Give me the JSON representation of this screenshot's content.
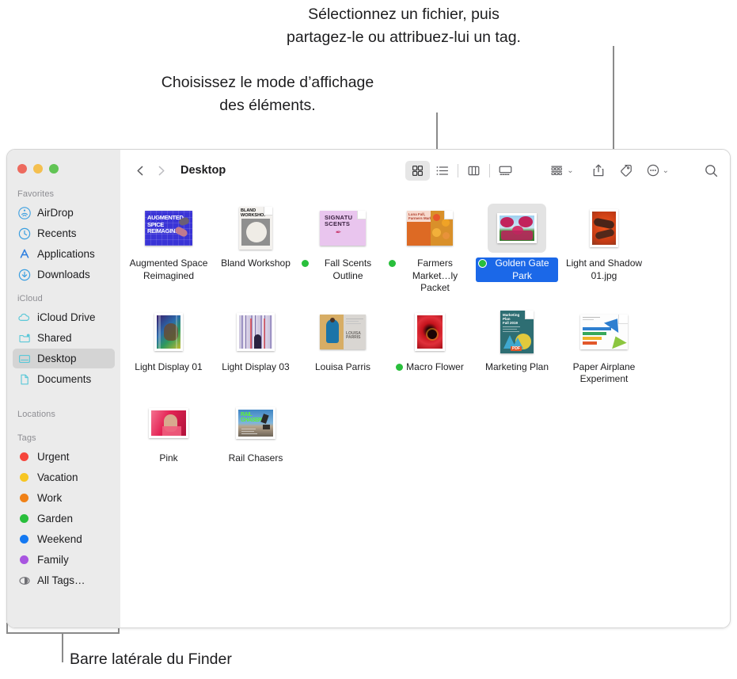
{
  "annotations": {
    "top": "Sélectionnez un fichier, puis\npartagez-le ou attribuez-lui un tag.",
    "left": "Choisissez le mode d’affichage\ndes éléments.",
    "bottom": "Barre latérale du Finder"
  },
  "window": {
    "traffic_lights": [
      "close",
      "minimize",
      "zoom"
    ],
    "colors": {
      "close": "#ed6a5e",
      "minimize": "#f4bf4f",
      "zoom": "#61c454"
    }
  },
  "toolbar": {
    "back_label": "Back",
    "forward_label": "Forward",
    "path_title": "Desktop",
    "views": [
      {
        "name": "icon-view",
        "label": "Icon View",
        "active": true
      },
      {
        "name": "list-view",
        "label": "List View",
        "active": false
      },
      {
        "name": "column-view",
        "label": "Column View",
        "active": false
      },
      {
        "name": "gallery-view",
        "label": "Gallery View",
        "active": false
      }
    ],
    "group_label": "Group",
    "share_label": "Share",
    "tag_label": "Tag",
    "more_label": "More",
    "search_label": "Search"
  },
  "sidebar": {
    "sections": [
      {
        "title": "Favorites",
        "items": [
          {
            "label": "AirDrop",
            "icon": "airdrop-icon",
            "selected": false
          },
          {
            "label": "Recents",
            "icon": "clock-icon",
            "selected": false
          },
          {
            "label": "Applications",
            "icon": "applications-icon",
            "selected": false
          },
          {
            "label": "Downloads",
            "icon": "downloads-icon",
            "selected": false
          }
        ]
      },
      {
        "title": "iCloud",
        "items": [
          {
            "label": "iCloud Drive",
            "icon": "cloud-icon",
            "selected": false
          },
          {
            "label": "Shared",
            "icon": "shared-folder-icon",
            "selected": false
          },
          {
            "label": "Desktop",
            "icon": "desktop-icon",
            "selected": true
          },
          {
            "label": "Documents",
            "icon": "document-icon",
            "selected": false
          }
        ]
      },
      {
        "title": "Locations",
        "items": []
      },
      {
        "title": "Tags",
        "items": [
          {
            "label": "Urgent",
            "icon": "tag-dot",
            "color": "#f6453c",
            "selected": false
          },
          {
            "label": "Vacation",
            "icon": "tag-dot",
            "color": "#f7c623",
            "selected": false
          },
          {
            "label": "Work",
            "icon": "tag-dot",
            "color": "#f08117",
            "selected": false
          },
          {
            "label": "Garden",
            "icon": "tag-dot",
            "color": "#29bf3c",
            "selected": false
          },
          {
            "label": "Weekend",
            "icon": "tag-dot",
            "color": "#1479f2",
            "selected": false
          },
          {
            "label": "Family",
            "icon": "tag-dot",
            "color": "#a855e0",
            "selected": false
          },
          {
            "label": "All Tags…",
            "icon": "all-tags-icon",
            "color": "",
            "selected": false
          }
        ]
      }
    ]
  },
  "files": [
    {
      "name": "Augmented\nSpace Reimagined",
      "kind": "poster",
      "tag": "",
      "selected": false
    },
    {
      "name": "Bland Workshop",
      "kind": "doc",
      "tag": "",
      "selected": false
    },
    {
      "name": "Fall Scents\nOutline",
      "kind": "doc",
      "tag": "#29bf3c",
      "selected": false
    },
    {
      "name": "Farmers\nMarket…ly Packet",
      "kind": "doc",
      "tag": "#29bf3c",
      "selected": false
    },
    {
      "name": "Golden Gate\nPark",
      "kind": "photo",
      "tag": "#29bf3c",
      "selected": true
    },
    {
      "name": "Light and Shadow\n01.jpg",
      "kind": "photo",
      "tag": "",
      "selected": false
    },
    {
      "name": "Light Display 01",
      "kind": "photo",
      "tag": "",
      "selected": false
    },
    {
      "name": "Light Display 03",
      "kind": "photo",
      "tag": "",
      "selected": false
    },
    {
      "name": "Louisa Parris",
      "kind": "poster",
      "tag": "",
      "selected": false
    },
    {
      "name": "Macro Flower",
      "kind": "photo",
      "tag": "#29bf3c",
      "selected": false
    },
    {
      "name": "Marketing Plan",
      "kind": "pdf",
      "tag": "",
      "selected": false
    },
    {
      "name": "Paper Airplane\nExperiment",
      "kind": "doc",
      "tag": "",
      "selected": false
    },
    {
      "name": "Pink",
      "kind": "photo",
      "tag": "",
      "selected": false
    },
    {
      "name": "Rail Chasers",
      "kind": "photo",
      "tag": "",
      "selected": false
    }
  ],
  "theme": {
    "selection_blue": "#1b68e8",
    "sidebar_bg": "#ebebeb",
    "content_bg": "#ffffff",
    "callout_line": "#8a8a8a"
  }
}
